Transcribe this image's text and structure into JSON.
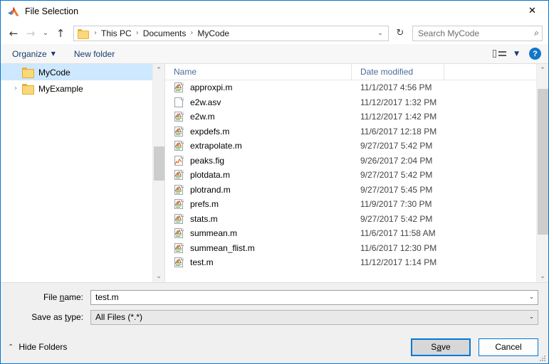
{
  "window": {
    "title": "File Selection",
    "logo_icon": "matlab-membrane-icon",
    "close_icon": "✕"
  },
  "nav": {
    "back_icon": "←",
    "forward_icon": "→",
    "recent_icon": "⌄",
    "up_icon": "↑",
    "refresh_icon": "↻",
    "breadcrumb": [
      "This PC",
      "Documents",
      "MyCode"
    ],
    "breadcrumb_separator": "›",
    "breadcrumb_caret": "⌄"
  },
  "search": {
    "placeholder": "Search MyCode",
    "icon": "search-icon",
    "icon_glyph": "⌕"
  },
  "toolbar": {
    "organize_label": "Organize",
    "organize_caret": "▼",
    "new_folder_label": "New folder",
    "view_caret": "▼",
    "help_label": "?"
  },
  "sidebar": {
    "items": [
      {
        "label": "MyCode",
        "selected": true,
        "has_chevron": false,
        "chevron": ""
      },
      {
        "label": "MyExample",
        "selected": false,
        "has_chevron": true,
        "chevron": "›"
      }
    ],
    "scroll": {
      "up_arrow": "⌃",
      "down_arrow": "⌄"
    }
  },
  "filelist": {
    "columns": [
      "Name",
      "Date modified",
      ""
    ],
    "sort_caret": "⌃",
    "scroll": {
      "up_arrow": "⌃",
      "down_arrow": "⌄"
    },
    "rows": [
      {
        "name": "approxpi.m",
        "date": "11/1/2017 4:56 PM",
        "icon": "matlab-file-icon"
      },
      {
        "name": "e2w.asv",
        "date": "11/12/2017 1:32 PM",
        "icon": "blank-file-icon"
      },
      {
        "name": "e2w.m",
        "date": "11/12/2017 1:42 PM",
        "icon": "matlab-file-icon"
      },
      {
        "name": "expdefs.m",
        "date": "11/6/2017 12:18 PM",
        "icon": "matlab-file-icon"
      },
      {
        "name": "extrapolate.m",
        "date": "9/27/2017 5:42 PM",
        "icon": "matlab-file-icon"
      },
      {
        "name": "peaks.fig",
        "date": "9/26/2017 2:04 PM",
        "icon": "matlab-figure-icon"
      },
      {
        "name": "plotdata.m",
        "date": "9/27/2017 5:42 PM",
        "icon": "matlab-file-icon"
      },
      {
        "name": "plotrand.m",
        "date": "9/27/2017 5:45 PM",
        "icon": "matlab-file-icon"
      },
      {
        "name": "prefs.m",
        "date": "11/9/2017 7:30 PM",
        "icon": "matlab-file-icon"
      },
      {
        "name": "stats.m",
        "date": "9/27/2017 5:42 PM",
        "icon": "matlab-file-icon"
      },
      {
        "name": "summean.m",
        "date": "11/6/2017 11:58 AM",
        "icon": "matlab-file-icon"
      },
      {
        "name": "summean_flist.m",
        "date": "11/6/2017 12:30 PM",
        "icon": "matlab-file-icon"
      },
      {
        "name": "test.m",
        "date": "11/12/2017 1:14 PM",
        "icon": "matlab-file-icon"
      }
    ]
  },
  "form": {
    "filename_label_pre": "File ",
    "filename_label_acc": "n",
    "filename_label_post": "ame:",
    "filename_value": "test.m",
    "savetype_label_pre": "Save as ",
    "savetype_label_acc": "t",
    "savetype_label_post": "ype:",
    "savetype_value": "All Files (*.*)",
    "dropdown_caret": "⌄"
  },
  "footer": {
    "hide_folders_label": "Hide Folders",
    "hide_folders_caret": "⌃",
    "save_pre": "S",
    "save_acc": "a",
    "save_post": "ve",
    "cancel_label": "Cancel"
  },
  "colors": {
    "accent": "#0078d7",
    "selection": "#cde8ff",
    "header_text": "#4a6c9b",
    "folder": "#fcd77a"
  }
}
